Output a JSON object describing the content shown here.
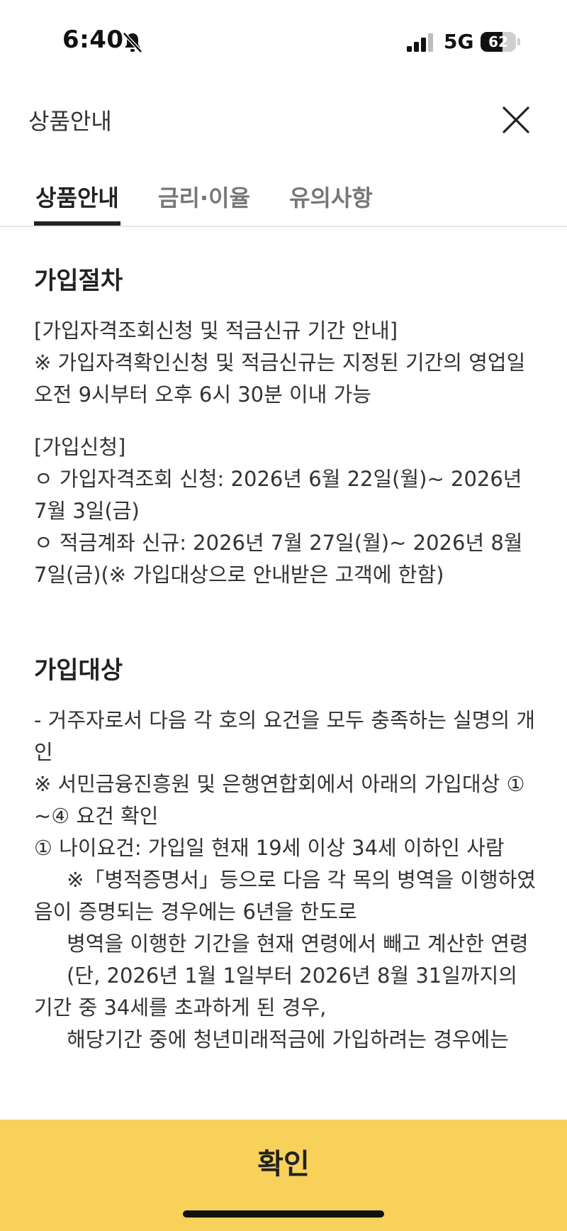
{
  "status_bar": {
    "time": "6:40",
    "network": "5G",
    "battery_level": "62",
    "battery_fraction": 0.62
  },
  "header": {
    "title": "상품안내",
    "close_icon": "close-icon"
  },
  "tabs": [
    {
      "label": "상품안내",
      "active": true
    },
    {
      "label": "금리·이율",
      "active": false
    },
    {
      "label": "유의사항",
      "active": false
    }
  ],
  "sections": {
    "procedure": {
      "title": "가입절차",
      "p1": "[가입자격조회신청 및 적금신규 기간 안내]\n※ 가입자격확인신청 및 적금신규는 지정된 기간의 영업일 오전 9시부터 오후 6시 30분 이내 가능",
      "p2": "[가입신청]\nㅇ 가입자격조회 신청: 2026년 6월 22일(월)~ 2026년 7월 3일(금)\nㅇ 적금계좌 신규: 2026년 7월 27일(월)~ 2026년 8월 7일(금)(※ 가입대상으로 안내받은 고객에 한함)"
    },
    "eligibility": {
      "title": "가입대상",
      "p1": "- 거주자로서 다음 각 호의 요건을 모두 충족하는 실명의 개인\n※ 서민금융진흥원 및 은행연합회에서 아래의 가입대상 ①~④ 요건 확인\n① 나이요건: 가입일 현재 19세 이상 34세 이하인 사람\n     ※「병적증명서」등으로 다음 각 목의 병역을 이행하였음이 증명되는 경우에는 6년을 한도로\n     병역을 이행한 기간을 현재 연령에서 빼고 계산한 연령\n     (단, 2026년 1월 1일부터 2026년 8월 31일까지의 기간 중 34세를 초과하게 된 경우,\n     해당기간 중에 청년미래적금에 가입하려는 경우에는"
    }
  },
  "confirm": {
    "label": "확인"
  }
}
